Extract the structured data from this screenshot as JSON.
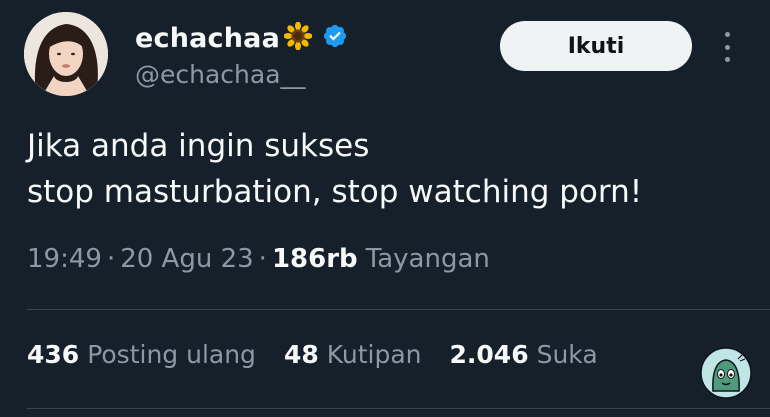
{
  "author": {
    "display_name": "echachaa",
    "name_emoji": "sunflower-icon",
    "verified_icon": "verified-badge-icon",
    "handle": "@echachaa__"
  },
  "actions": {
    "follow_label": "Ikuti",
    "more_icon": "more-vertical-icon"
  },
  "tweet": {
    "lines": [
      "Jika anda ingin sukses",
      "stop masturbation, stop watching porn!"
    ],
    "time": "19:49",
    "separator": "·",
    "date": "20 Agu 23",
    "views_count": "186rb",
    "views_label": "Tayangan"
  },
  "stats": {
    "reposts_count": "436",
    "reposts_label": "Posting ulang",
    "quotes_count": "48",
    "quotes_label": "Kutipan",
    "likes_count": "2.046",
    "likes_label": "Suka"
  },
  "colors": {
    "background": "#15202b",
    "text_primary": "#f7f9f9",
    "text_secondary": "#8b98a5",
    "verified": "#1d9bf0",
    "divider": "#38444d"
  }
}
